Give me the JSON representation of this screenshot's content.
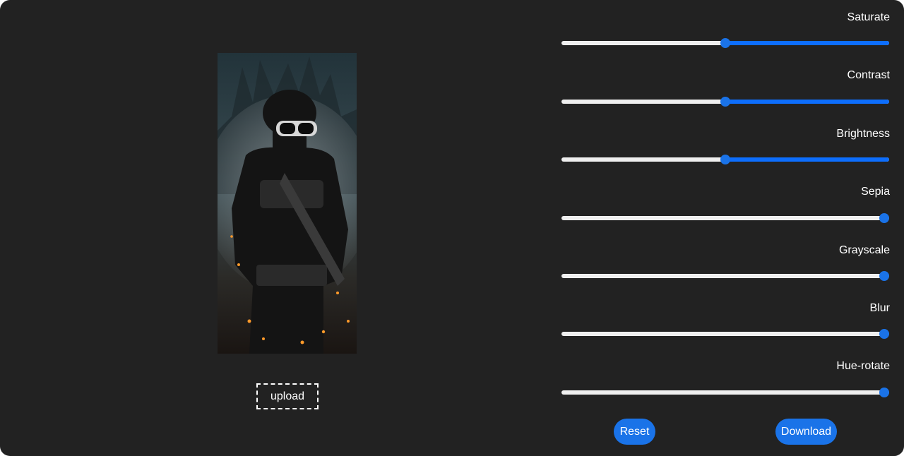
{
  "preview": {
    "image_description": "soldier-with-rifle-photo"
  },
  "upload": {
    "label": "upload"
  },
  "filters": [
    {
      "key": "saturate",
      "label": "Saturate",
      "value": 0.5
    },
    {
      "key": "contrast",
      "label": "Contrast",
      "value": 0.5
    },
    {
      "key": "brightness",
      "label": "Brightness",
      "value": 0.5
    },
    {
      "key": "sepia",
      "label": "Sepia",
      "value": 1.0
    },
    {
      "key": "grayscale",
      "label": "Grayscale",
      "value": 1.0
    },
    {
      "key": "blur",
      "label": "Blur",
      "value": 1.0
    },
    {
      "key": "hue-rotate",
      "label": "Hue-rotate",
      "value": 1.0
    }
  ],
  "actions": {
    "reset_label": "Reset",
    "download_label": "Download"
  },
  "colors": {
    "background": "#222222",
    "accent": "#1a73e8",
    "track": "#efefef",
    "text": "#ffffff"
  }
}
